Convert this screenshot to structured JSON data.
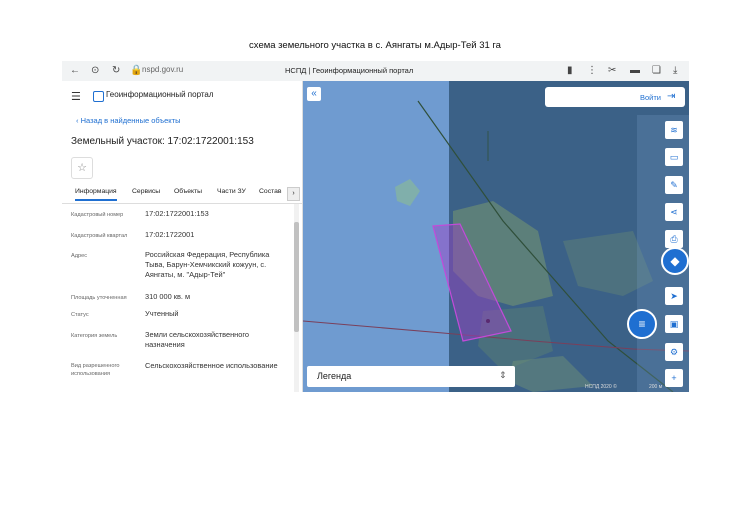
{
  "document": {
    "caption": "схема земельного участка в с. Аянгаты м.Адыр-Тей 31  га"
  },
  "browser": {
    "url": "nspd.gov.ru",
    "tab_title": "НСПД | Геоинформационный портал",
    "icons": [
      "back-arrow-icon",
      "lock-icon",
      "reload-icon",
      "bookmark-icon",
      "extension-icon",
      "download-icon"
    ]
  },
  "panel": {
    "portal_name": "Геоинформационный портал",
    "back_link": "Назад в найденные объекты",
    "title": "Земельный участок: 17:02:1722001:153",
    "tabs": [
      "Информация",
      "Сервисы",
      "Объекты",
      "Части ЗУ",
      "Состав"
    ],
    "active_tab": "Информация",
    "details": [
      {
        "label": "Кадастровый номер",
        "value": "17:02:1722001:153"
      },
      {
        "label": "Кадастровый квартал",
        "value": "17:02:1722001"
      },
      {
        "label": "Адрес",
        "value": "Российская Федерация, Республика Тыва, Барун-Хемчикский кожуун, с. Аянгаты, м. \"Адыр-Тей\""
      },
      {
        "label": "Площадь уточненная",
        "value": "310 000 кв. м"
      },
      {
        "label": "Статус",
        "value": "Учтенный"
      },
      {
        "label": "Категория земель",
        "value": "Земли сельскохозяйственного назначения"
      },
      {
        "label": "Вид разрешенного использования",
        "value": "Сельскохозяйственное использование"
      }
    ]
  },
  "map": {
    "login_label": "Войти",
    "legend_label": "Легенда",
    "copyright": "НСПД 2020 ©",
    "scale": "200 м",
    "accent_color": "#1f6fd1",
    "parcel_color": "#a040c8"
  }
}
